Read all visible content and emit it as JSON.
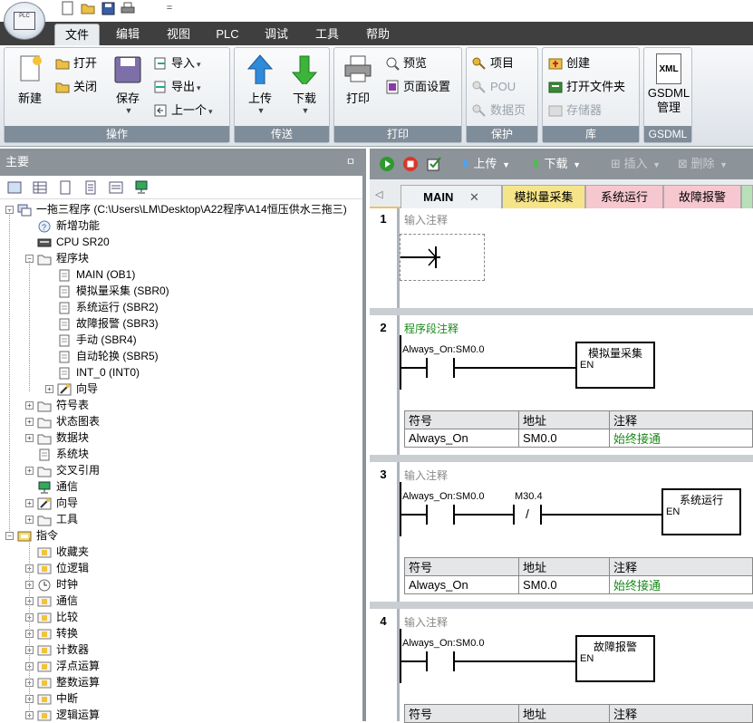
{
  "app": {
    "logo_text": "PLC"
  },
  "qat": {
    "more": "="
  },
  "menu": {
    "tabs": [
      "文件",
      "编辑",
      "视图",
      "PLC",
      "调试",
      "工具",
      "帮助"
    ],
    "active": 0
  },
  "ribbon": {
    "groups": {
      "operation": {
        "caption": "操作",
        "new": "新建",
        "open": "打开",
        "close": "关闭",
        "save": "保存",
        "import": "导入",
        "export": "导出",
        "previous": "上一个"
      },
      "transfer": {
        "caption": "传送",
        "upload": "上传",
        "download": "下载"
      },
      "print": {
        "caption": "打印",
        "print": "打印",
        "preview": "预览",
        "page_setup": "页面设置"
      },
      "protect": {
        "caption": "保护",
        "project": "项目",
        "pou": "POU",
        "datapage": "数据页"
      },
      "library": {
        "caption": "库",
        "create": "创建",
        "open_folder": "打开文件夹",
        "memory": "存储器"
      },
      "gsdml": {
        "caption": "GSDML",
        "manage": "GSDML\n管理",
        "xml": "XML"
      }
    }
  },
  "left": {
    "header": "主要",
    "pin": "ㅁ",
    "tree": [
      {
        "label": "一拖三程序 (C:\\Users\\LM\\Desktop\\A22程序\\A14恒压供水三拖三)",
        "level": 0,
        "exp": "−",
        "icon": "project"
      },
      {
        "label": "新增功能",
        "level": 1,
        "icon": "help"
      },
      {
        "label": "CPU SR20",
        "level": 1,
        "icon": "cpu"
      },
      {
        "label": "程序块",
        "level": 1,
        "exp": "−",
        "icon": "folder"
      },
      {
        "label": "MAIN (OB1)",
        "level": 2,
        "icon": "prog"
      },
      {
        "label": "模拟量采集 (SBR0)",
        "level": 2,
        "icon": "prog"
      },
      {
        "label": "系统运行 (SBR2)",
        "level": 2,
        "icon": "prog"
      },
      {
        "label": "故障报警 (SBR3)",
        "level": 2,
        "icon": "prog"
      },
      {
        "label": "手动 (SBR4)",
        "level": 2,
        "icon": "prog"
      },
      {
        "label": "自动轮换 (SBR5)",
        "level": 2,
        "icon": "prog"
      },
      {
        "label": "INT_0 (INT0)",
        "level": 2,
        "icon": "prog"
      },
      {
        "label": "向导",
        "level": 2,
        "exp": "+",
        "icon": "wizard"
      },
      {
        "label": "符号表",
        "level": 1,
        "exp": "+",
        "icon": "folder"
      },
      {
        "label": "状态图表",
        "level": 1,
        "exp": "+",
        "icon": "folder"
      },
      {
        "label": "数据块",
        "level": 1,
        "exp": "+",
        "icon": "folder"
      },
      {
        "label": "系统块",
        "level": 1,
        "icon": "sys"
      },
      {
        "label": "交叉引用",
        "level": 1,
        "exp": "+",
        "icon": "folder"
      },
      {
        "label": "通信",
        "level": 1,
        "icon": "comm"
      },
      {
        "label": "向导",
        "level": 1,
        "exp": "+",
        "icon": "wizard"
      },
      {
        "label": "工具",
        "level": 1,
        "exp": "+",
        "icon": "folder"
      },
      {
        "label": "指令",
        "level": 0,
        "exp": "−",
        "icon": "instr"
      },
      {
        "label": "收藏夹",
        "level": 1,
        "icon": "ins"
      },
      {
        "label": "位逻辑",
        "level": 1,
        "exp": "+",
        "icon": "ins"
      },
      {
        "label": "时钟",
        "level": 1,
        "exp": "+",
        "icon": "clock"
      },
      {
        "label": "通信",
        "level": 1,
        "exp": "+",
        "icon": "ins"
      },
      {
        "label": "比较",
        "level": 1,
        "exp": "+",
        "icon": "ins"
      },
      {
        "label": "转换",
        "level": 1,
        "exp": "+",
        "icon": "ins"
      },
      {
        "label": "计数器",
        "level": 1,
        "exp": "+",
        "icon": "ins"
      },
      {
        "label": "浮点运算",
        "level": 1,
        "exp": "+",
        "icon": "ins"
      },
      {
        "label": "整数运算",
        "level": 1,
        "exp": "+",
        "icon": "ins"
      },
      {
        "label": "中断",
        "level": 1,
        "exp": "+",
        "icon": "ins"
      },
      {
        "label": "逻辑运算",
        "level": 1,
        "exp": "+",
        "icon": "ins"
      }
    ]
  },
  "right": {
    "toolbar": {
      "upload": "上传",
      "download": "下载",
      "insert": "插入",
      "delete": "删除"
    },
    "tabs": [
      {
        "label": "MAIN",
        "close": "✕",
        "color": "#eef1f4"
      },
      {
        "label": "模拟量采集",
        "color": "#f6e48a"
      },
      {
        "label": "系统运行",
        "color": "#f6c7cf"
      },
      {
        "label": "故障报警",
        "color": "#f6c7cf"
      }
    ],
    "networks": [
      {
        "num": "1",
        "comment": "输入注释"
      },
      {
        "num": "2",
        "comment": "程序段注释",
        "contact": "Always_On:SM0.0",
        "box": "模拟量采集",
        "en": "EN",
        "table": {
          "headers": [
            "符号",
            "地址",
            "注释"
          ],
          "row": [
            "Always_On",
            "SM0.0",
            "始终接通"
          ]
        }
      },
      {
        "num": "3",
        "comment": "输入注释",
        "contact": "Always_On:SM0.0",
        "contact2": "M30.4",
        "not": "/",
        "box": "系统运行",
        "en": "EN",
        "table": {
          "headers": [
            "符号",
            "地址",
            "注释"
          ],
          "row": [
            "Always_On",
            "SM0.0",
            "始终接通"
          ]
        }
      },
      {
        "num": "4",
        "comment": "输入注释",
        "contact": "Always_On:SM0.0",
        "box": "故障报警",
        "en": "EN",
        "table": {
          "headers": [
            "符号",
            "地址",
            "注释"
          ],
          "row": []
        }
      }
    ]
  },
  "colors": {
    "accent": "#e8c36a",
    "header": "#8c9399",
    "menubar": "#3f3f3f",
    "comment_green": "#1a8a1a"
  }
}
